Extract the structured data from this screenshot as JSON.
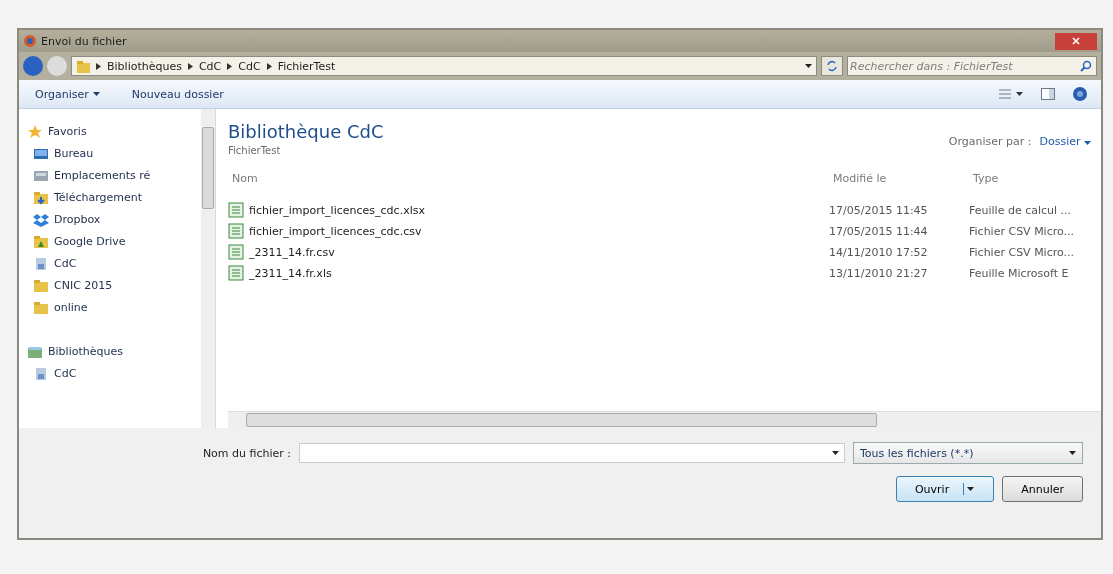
{
  "window": {
    "title": "Envoi du fichier"
  },
  "breadcrumb": [
    "Bibliothèques",
    "CdC",
    "CdC",
    "FichierTest"
  ],
  "search": {
    "placeholder": "Rechercher dans : FichierTest"
  },
  "toolbar": [
    "Organiser",
    "Nouveau dossier"
  ],
  "sidebar": {
    "items": [
      {
        "label": "Favoris",
        "kind": "group"
      },
      {
        "label": "Bureau",
        "kind": "item"
      },
      {
        "label": "Emplacements ré",
        "kind": "item"
      },
      {
        "label": "Téléchargement",
        "kind": "item"
      },
      {
        "label": "Dropbox",
        "kind": "item"
      },
      {
        "label": "Google Drive",
        "kind": "item"
      },
      {
        "label": "CdC",
        "kind": "item"
      },
      {
        "label": "CNIC 2015",
        "kind": "item"
      },
      {
        "label": "online",
        "kind": "item"
      },
      {
        "label": "Bibliothèques",
        "kind": "group"
      },
      {
        "label": "CdC",
        "kind": "item"
      }
    ]
  },
  "library": {
    "title": "Bibliothèque CdC",
    "subtitle": "FichierTest",
    "arrange_label": "Organiser par :",
    "arrange_value": "Dossier"
  },
  "table": {
    "columns": [
      "Nom",
      "Modifié le",
      "Type"
    ],
    "rows": [
      [
        "fichier_import_licences_cdc.xlsx",
        "17/05/2015 11:45",
        "Feuille de calcul ..."
      ],
      [
        "fichier_import_licences_cdc.csv",
        "17/05/2015 11:44",
        "Fichier CSV Micro..."
      ],
      [
        "_2311_14.fr.csv",
        "14/11/2010 17:52",
        "Fichier CSV Micro..."
      ],
      [
        "_2311_14.fr.xls",
        "13/11/2010 21:27",
        "Feuille Microsoft E"
      ]
    ]
  },
  "filename": {
    "label": "Nom du fichier :"
  },
  "filter": {
    "value": "Tous les fichiers (*.*)"
  },
  "buttons": [
    "Ouvrir",
    "Annuler"
  ]
}
